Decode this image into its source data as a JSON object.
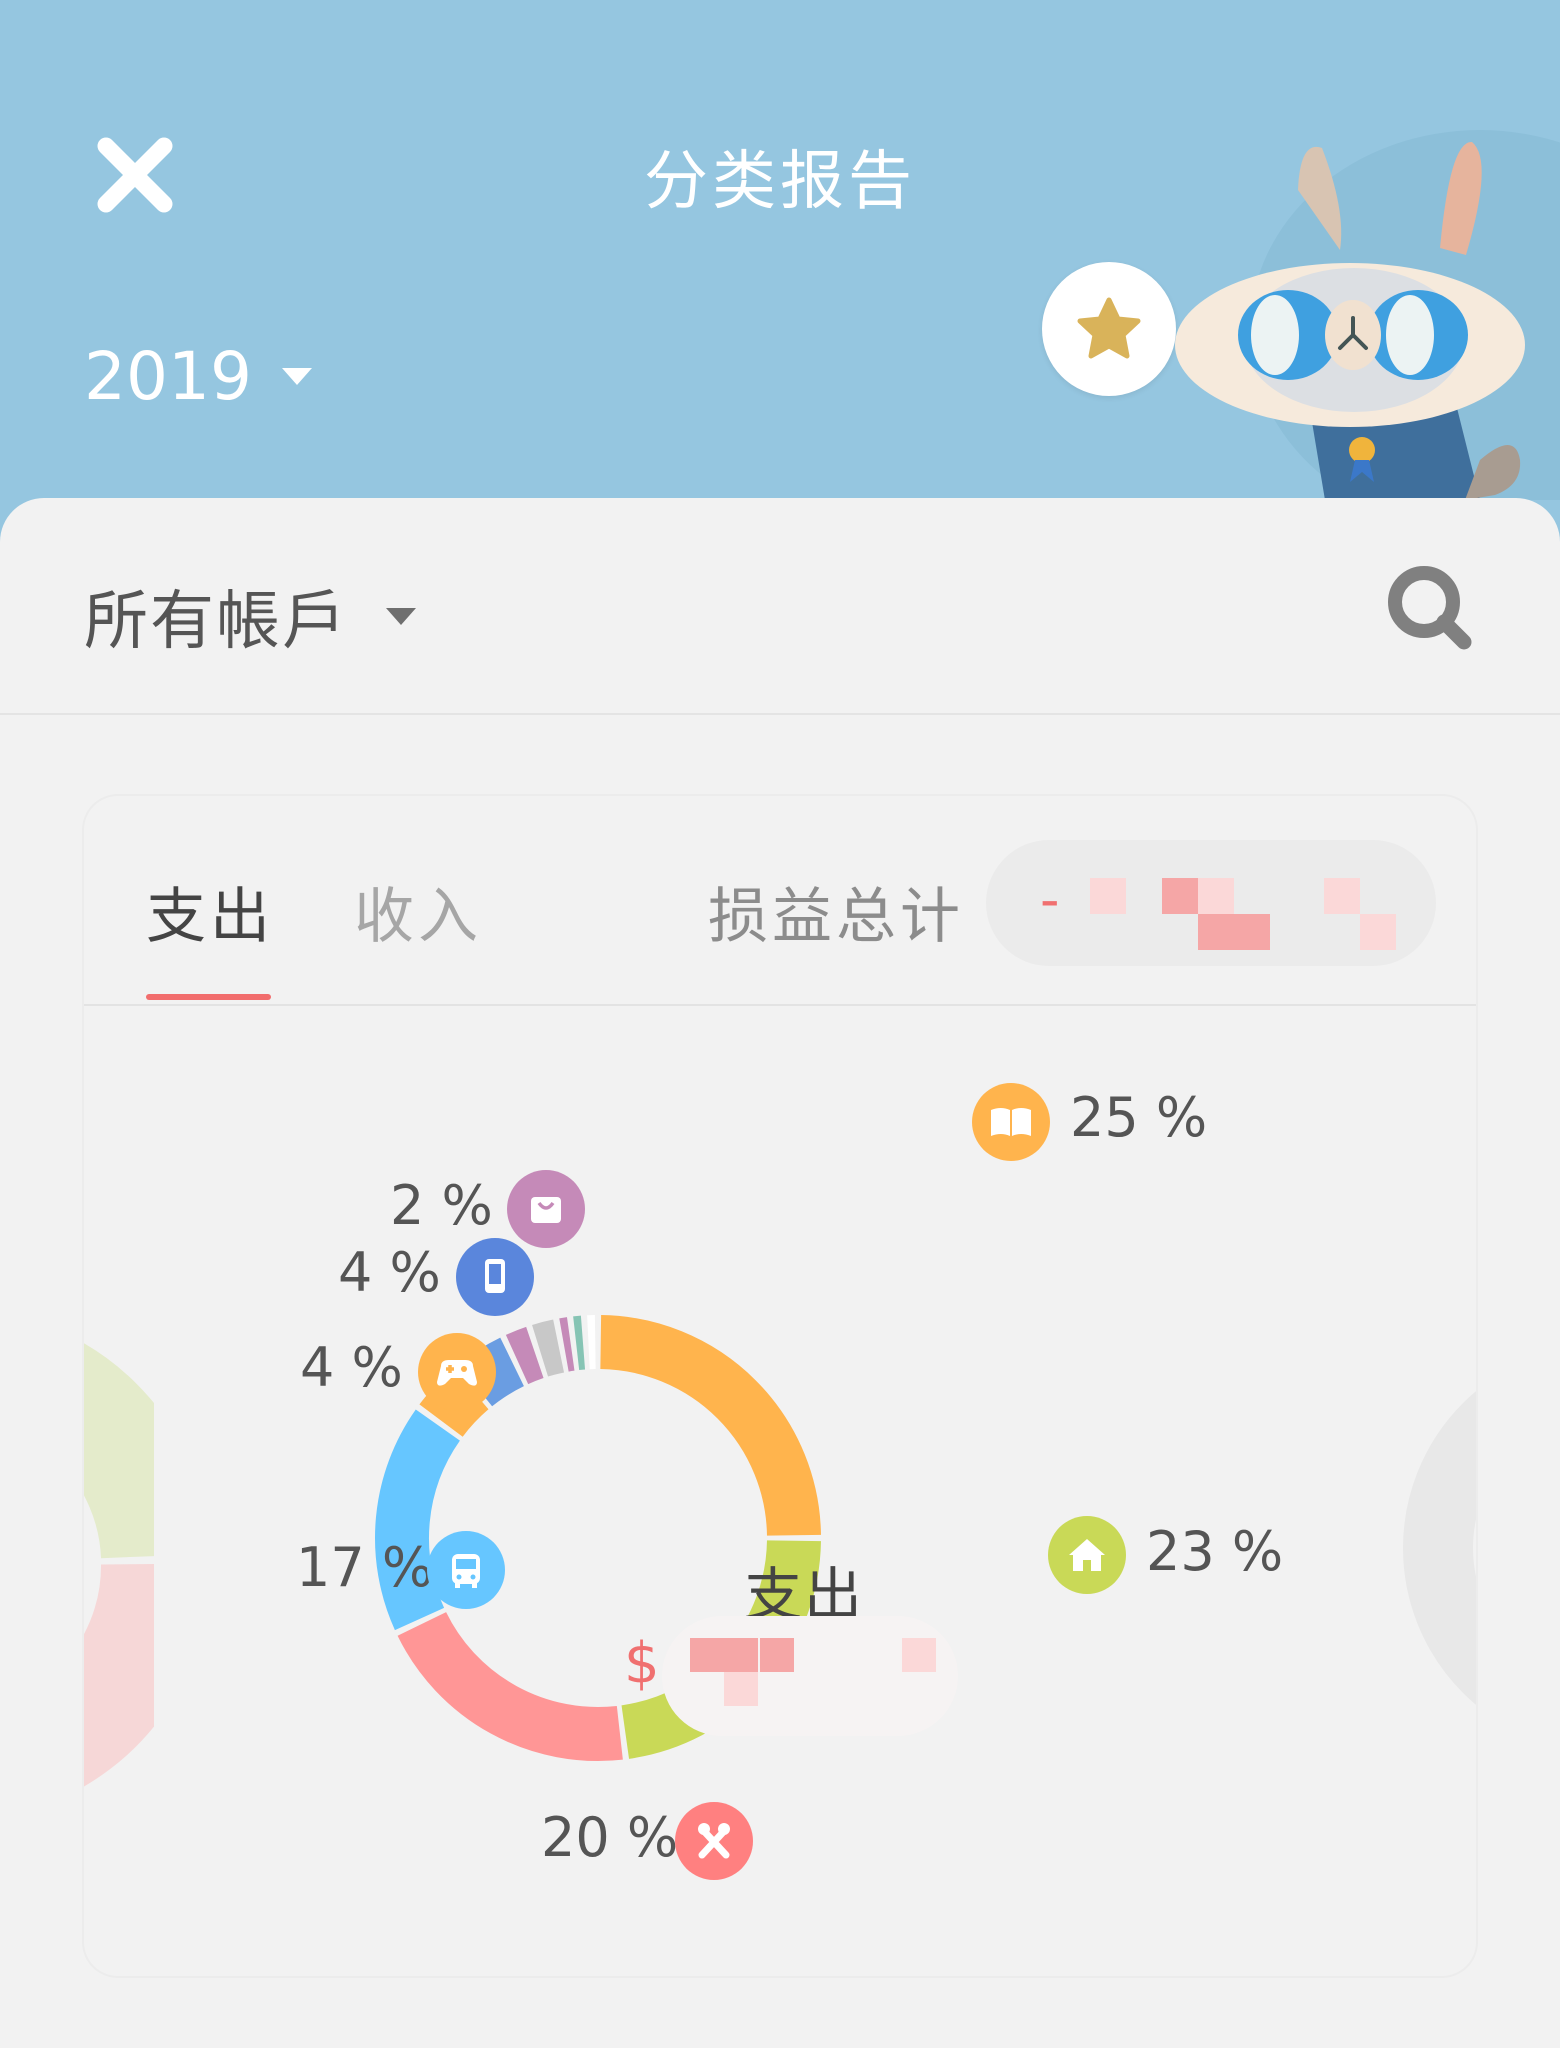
{
  "header": {
    "title": "分类报告",
    "year": "2019",
    "close_icon": "close-icon",
    "badge_icon": "star-icon",
    "bg_color": "#95c6e0"
  },
  "filter": {
    "account": "所有帳戶",
    "search_icon": "search-icon"
  },
  "tabs": [
    {
      "label": "支出",
      "active": true
    },
    {
      "label": "收入",
      "active": false
    }
  ],
  "summary": {
    "label": "损益总计",
    "value_prefix": "-"
  },
  "chart_center": {
    "label": "支出",
    "amount_prefix": "$"
  },
  "chart_data": {
    "type": "pie",
    "title": "支出",
    "slices": [
      {
        "category": "book-icon",
        "percent": 25,
        "label": "25 %",
        "color": "#ffb44d"
      },
      {
        "category": "home-icon",
        "percent": 23,
        "label": "23 %",
        "color": "#c9d957"
      },
      {
        "category": "dining-icon",
        "percent": 20,
        "label": "20 %",
        "color": "#ff9696"
      },
      {
        "category": "bus-icon",
        "percent": 17,
        "label": "17 %",
        "color": "#66c6ff"
      },
      {
        "category": "game-icon",
        "percent": 4,
        "label": "4 %",
        "color": "#ffb44d"
      },
      {
        "category": "phone-icon",
        "percent": 4,
        "label": "4 %",
        "color": "#6a9de2"
      },
      {
        "category": "shopping-icon",
        "percent": 2,
        "label": "2 %",
        "color": "#c58ab8"
      },
      {
        "category": "",
        "percent": 2,
        "label": "",
        "color": "#c8c8c8"
      },
      {
        "category": "",
        "percent": 1,
        "label": "",
        "color": "#c58ab8"
      },
      {
        "category": "",
        "percent": 1,
        "label": "",
        "color": "#86c4b4"
      },
      {
        "category": "",
        "percent": 1,
        "label": "",
        "color": "#ffffff"
      }
    ]
  }
}
